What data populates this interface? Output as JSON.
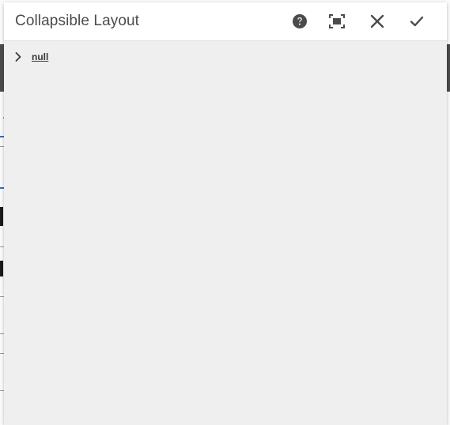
{
  "dialog": {
    "title": "Collapsible Layout",
    "buttons": {
      "help_icon": "help-icon",
      "fullscreen_icon": "fullscreen-icon",
      "close_icon": "close-icon",
      "done_icon": "checkmark-icon"
    }
  },
  "tree": {
    "items": [
      {
        "label": "null",
        "expanded": false,
        "icon": "chevron-right-icon"
      }
    ]
  },
  "colors": {
    "title_text": "#4b4b4b",
    "icon": "#4b4b4b",
    "body_bg": "#efefef",
    "header_bg": "#ffffff"
  }
}
